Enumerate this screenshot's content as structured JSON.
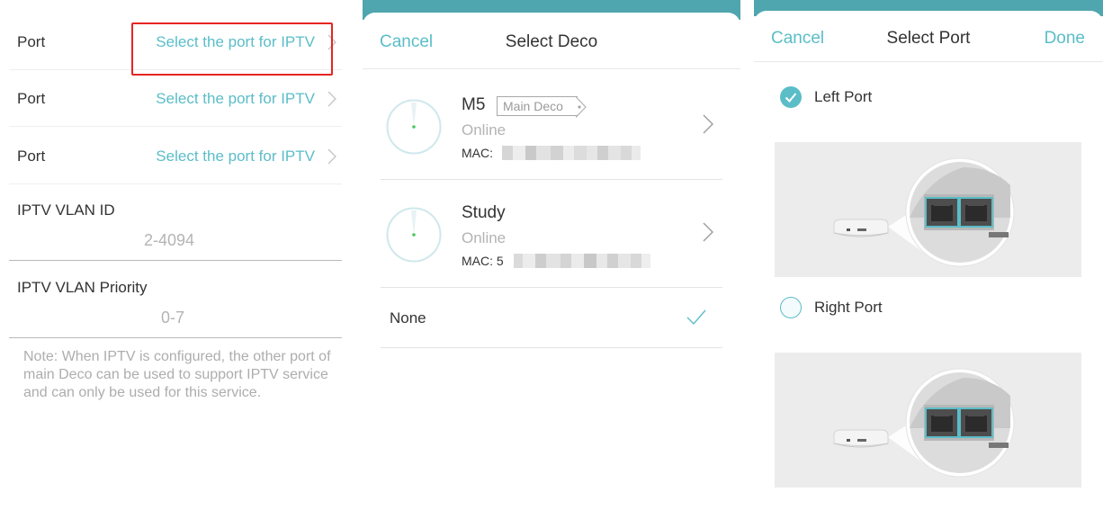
{
  "panel1": {
    "port_rows": [
      {
        "label": "Port",
        "value": "Select the port for IPTV"
      },
      {
        "label": "Port",
        "value": "Select the port for IPTV"
      },
      {
        "label": "Port",
        "value": "Select the port for IPTV"
      }
    ],
    "vlan_id": {
      "label": "IPTV VLAN ID",
      "placeholder": "2-4094"
    },
    "vlan_priority": {
      "label": "IPTV VLAN Priority",
      "placeholder": "0-7"
    },
    "note": "Note: When IPTV is configured, the other port of main Deco can be used to support IPTV service and can only be used for this service."
  },
  "panel2": {
    "cancel": "Cancel",
    "title": "Select Deco",
    "decos": [
      {
        "name": "M5",
        "badge": "Main Deco",
        "status": "Online",
        "mac_prefix": "MAC: "
      },
      {
        "name": "Study",
        "badge": "",
        "status": "Online",
        "mac_prefix": "MAC: 5"
      }
    ],
    "none_label": "None"
  },
  "panel3": {
    "cancel": "Cancel",
    "title": "Select Port",
    "done": "Done",
    "options": [
      {
        "label": "Left Port",
        "checked": true
      },
      {
        "label": "Right Port",
        "checked": false
      }
    ]
  },
  "colors": {
    "accent": "#5bbdc8",
    "highlight_box": "#e52521",
    "header_strip": "#4fa6ae"
  }
}
